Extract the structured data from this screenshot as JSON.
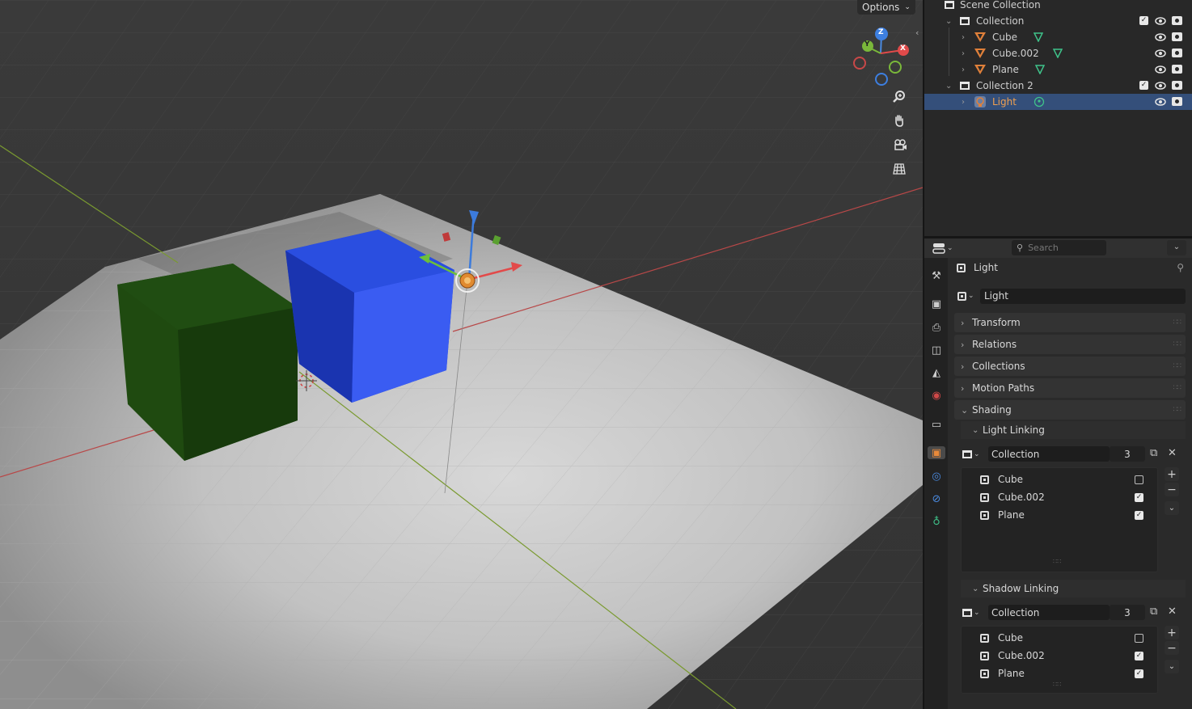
{
  "viewport": {
    "options_label": "Options",
    "gizmo": {
      "z": "Z",
      "y": "Y",
      "x": "X"
    },
    "nav_icons": [
      "zoom-icon",
      "hand-pan-icon",
      "camera-icon",
      "grid-view-icon"
    ]
  },
  "outliner": {
    "root_label": "Scene Collection",
    "rows": [
      {
        "label": "Collection",
        "kind": "collection"
      },
      {
        "label": "Cube",
        "kind": "mesh"
      },
      {
        "label": "Cube.002",
        "kind": "mesh"
      },
      {
        "label": "Plane",
        "kind": "mesh"
      },
      {
        "label": "Collection 2",
        "kind": "collection"
      },
      {
        "label": "Light",
        "kind": "light",
        "selected": true
      }
    ]
  },
  "properties": {
    "search_placeholder": "Search",
    "object_name": "Light",
    "datablock_name": "Light",
    "panels": [
      "Transform",
      "Relations",
      "Collections",
      "Motion Paths",
      "Shading"
    ],
    "light_linking": {
      "title": "Light Linking",
      "collection_label": "Collection",
      "count": "3",
      "items": [
        {
          "name": "Cube",
          "checked": false
        },
        {
          "name": "Cube.002",
          "checked": true
        },
        {
          "name": "Plane",
          "checked": true
        }
      ]
    },
    "shadow_linking": {
      "title": "Shadow Linking",
      "collection_label": "Collection",
      "count": "3",
      "items": [
        {
          "name": "Cube",
          "checked": false
        },
        {
          "name": "Cube.002",
          "checked": true
        },
        {
          "name": "Plane",
          "checked": true
        }
      ]
    }
  },
  "colors": {
    "accent_selected": "#344f7a",
    "mesh_orange": "#e0803a",
    "data_green": "#3fc28a",
    "green_cube": "#1f4a10",
    "blue_cube": "#1f3fd0"
  }
}
